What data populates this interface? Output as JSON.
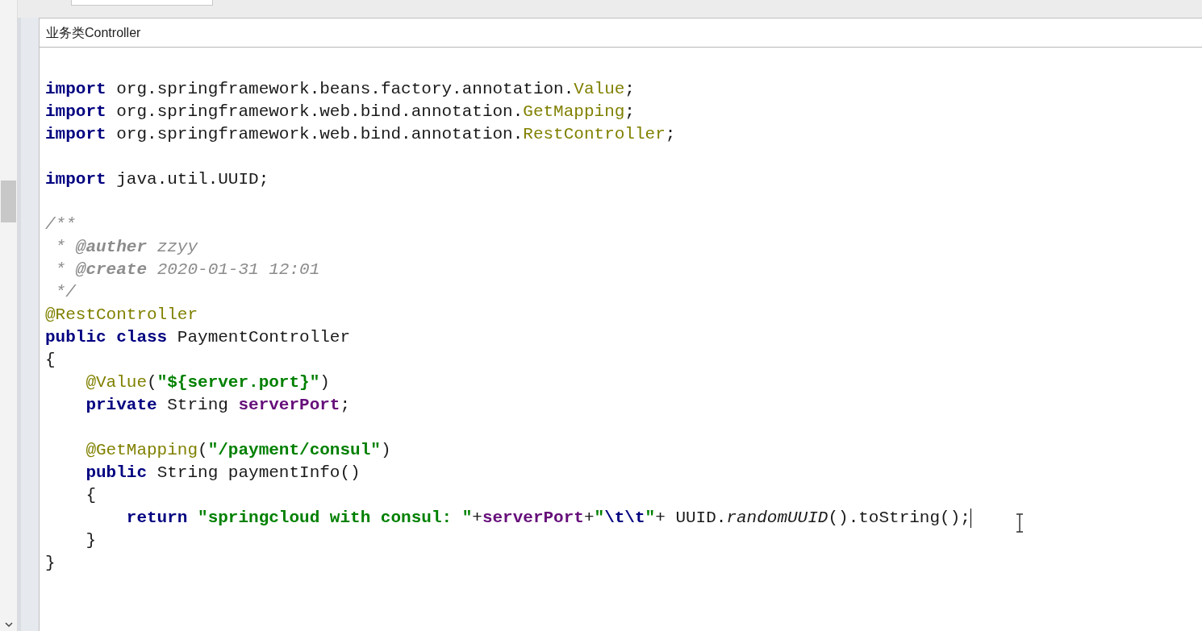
{
  "editor": {
    "title": "业务类Controller",
    "lines": [
      {
        "kind": "blank",
        "caret": false
      },
      {
        "kind": "code",
        "caret": false,
        "tokens": [
          {
            "kind": "keyword",
            "text": "import"
          },
          {
            "kind": "plain",
            "text": " org.springframework.beans.factory.annotation."
          },
          {
            "kind": "annotation",
            "text": "Value"
          },
          {
            "kind": "plain",
            "text": ";"
          }
        ]
      },
      {
        "kind": "code",
        "caret": false,
        "tokens": [
          {
            "kind": "keyword",
            "text": "import"
          },
          {
            "kind": "plain",
            "text": " org.springframework.web.bind.annotation."
          },
          {
            "kind": "annotation",
            "text": "GetMapping"
          },
          {
            "kind": "plain",
            "text": ";"
          }
        ]
      },
      {
        "kind": "code",
        "caret": false,
        "tokens": [
          {
            "kind": "keyword",
            "text": "import"
          },
          {
            "kind": "plain",
            "text": " org.springframework.web.bind.annotation."
          },
          {
            "kind": "annotation",
            "text": "RestController"
          },
          {
            "kind": "plain",
            "text": ";"
          }
        ]
      },
      {
        "kind": "blank",
        "caret": false
      },
      {
        "kind": "code",
        "caret": false,
        "tokens": [
          {
            "kind": "keyword",
            "text": "import"
          },
          {
            "kind": "plain",
            "text": " java.util.UUID;"
          }
        ]
      },
      {
        "kind": "blank",
        "caret": false
      },
      {
        "kind": "code",
        "caret": false,
        "tokens": [
          {
            "kind": "comment",
            "text": "/**"
          }
        ]
      },
      {
        "kind": "code",
        "caret": false,
        "tokens": [
          {
            "kind": "comment",
            "text": " * "
          },
          {
            "kind": "doctag",
            "text": "@auther"
          },
          {
            "kind": "comment",
            "text": " zzyy"
          }
        ]
      },
      {
        "kind": "code",
        "caret": false,
        "tokens": [
          {
            "kind": "comment",
            "text": " * "
          },
          {
            "kind": "doctag",
            "text": "@create"
          },
          {
            "kind": "comment",
            "text": " 2020-01-31 12:01"
          }
        ]
      },
      {
        "kind": "code",
        "caret": false,
        "tokens": [
          {
            "kind": "comment",
            "text": " */"
          }
        ]
      },
      {
        "kind": "code",
        "caret": false,
        "tokens": [
          {
            "kind": "annotation",
            "text": "@RestController"
          }
        ]
      },
      {
        "kind": "code",
        "caret": false,
        "tokens": [
          {
            "kind": "keyword",
            "text": "public class"
          },
          {
            "kind": "plain",
            "text": " PaymentController"
          }
        ]
      },
      {
        "kind": "code",
        "caret": false,
        "tokens": [
          {
            "kind": "plain",
            "text": "{"
          }
        ]
      },
      {
        "kind": "code",
        "caret": false,
        "tokens": [
          {
            "kind": "annotation",
            "text": "    @Value"
          },
          {
            "kind": "plain",
            "text": "("
          },
          {
            "kind": "string",
            "text": "\"${server.port}\""
          },
          {
            "kind": "plain",
            "text": ")"
          }
        ]
      },
      {
        "kind": "code",
        "caret": false,
        "tokens": [
          {
            "kind": "keyword",
            "text": "    private"
          },
          {
            "kind": "plain",
            "text": " String "
          },
          {
            "kind": "field",
            "text": "serverPort"
          },
          {
            "kind": "plain",
            "text": ";"
          }
        ]
      },
      {
        "kind": "blank",
        "caret": false
      },
      {
        "kind": "code",
        "caret": false,
        "tokens": [
          {
            "kind": "annotation",
            "text": "    @GetMapping"
          },
          {
            "kind": "plain",
            "text": "("
          },
          {
            "kind": "string",
            "text": "\"/payment/consul\""
          },
          {
            "kind": "plain",
            "text": ")"
          }
        ]
      },
      {
        "kind": "code",
        "caret": false,
        "tokens": [
          {
            "kind": "keyword",
            "text": "    public"
          },
          {
            "kind": "plain",
            "text": " String paymentInfo()"
          }
        ]
      },
      {
        "kind": "code",
        "caret": false,
        "tokens": [
          {
            "kind": "plain",
            "text": "    {"
          }
        ]
      },
      {
        "kind": "code",
        "caret": true,
        "tokens": [
          {
            "kind": "keyword",
            "text": "        return "
          },
          {
            "kind": "string",
            "text": "\"springcloud with consul: \""
          },
          {
            "kind": "plain",
            "text": "+"
          },
          {
            "kind": "field",
            "text": "serverPort"
          },
          {
            "kind": "plain",
            "text": "+"
          },
          {
            "kind": "string",
            "text": "\""
          },
          {
            "kind": "escape",
            "text": "\\t\\t"
          },
          {
            "kind": "string",
            "text": "\""
          },
          {
            "kind": "plain",
            "text": "+ UUID."
          },
          {
            "kind": "italic",
            "text": "randomUUID"
          },
          {
            "kind": "plain",
            "text": "().toString();"
          }
        ]
      },
      {
        "kind": "code",
        "caret": false,
        "tokens": [
          {
            "kind": "plain",
            "text": "    }"
          }
        ]
      },
      {
        "kind": "code",
        "caret": false,
        "tokens": [
          {
            "kind": "plain",
            "text": "}"
          }
        ]
      }
    ]
  }
}
